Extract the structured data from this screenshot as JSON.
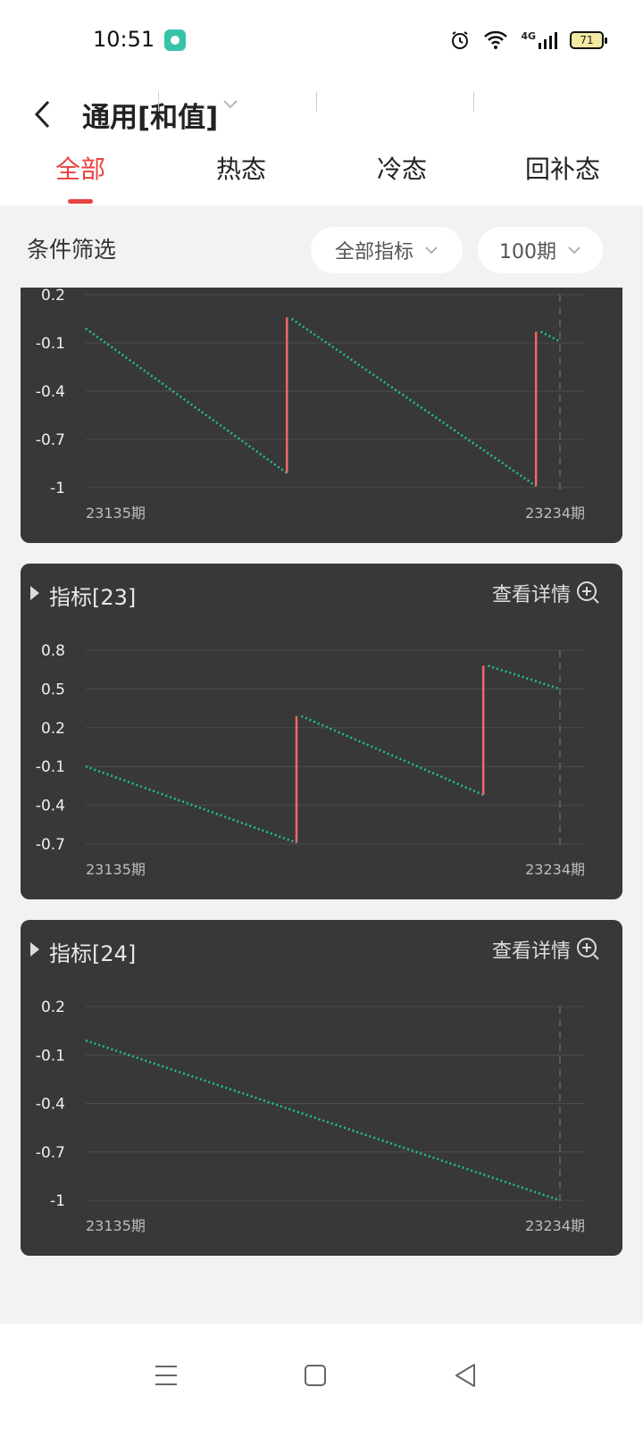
{
  "status_bar": {
    "time": "10:51",
    "network": "4G",
    "battery": "71",
    "icons": [
      "app-notification-icon",
      "alarm-icon",
      "wifi-icon",
      "signal-icon",
      "battery-icon"
    ]
  },
  "header": {
    "title": "通用[和值]",
    "tabs": [
      {
        "label": "全部",
        "active": true
      },
      {
        "label": "热态",
        "active": false
      },
      {
        "label": "冷态",
        "active": false
      },
      {
        "label": "回补态",
        "active": false
      }
    ]
  },
  "filter": {
    "label": "条件筛选",
    "indicator_select": "全部指标",
    "period_select": "100期"
  },
  "colors": {
    "accent": "#e8423f",
    "card_bg": "#383838",
    "line_green": "#1fc08a",
    "jump_red": "#ef6868"
  },
  "cards": [
    {
      "title": "",
      "detail_label": "",
      "chart_data": {
        "type": "line",
        "y_ticks": [
          "0.2",
          "-0.1",
          "-0.4",
          "-0.7",
          "-1"
        ],
        "ylim": [
          -1,
          0.2
        ],
        "x_range": [
          23135,
          23234
        ],
        "x_labels": [
          "23135期",
          "23234期"
        ],
        "segments": [
          {
            "from": [
              23135,
              -0.01
            ],
            "to": [
              23177,
              -0.91
            ]
          },
          {
            "from": [
              23178,
              0.05
            ],
            "to": [
              23229,
              -0.99
            ]
          },
          {
            "from": [
              23230,
              -0.03
            ],
            "to": [
              23234,
              -0.09
            ]
          }
        ],
        "jumps": [
          {
            "x": 23177,
            "from": -0.91,
            "to": 0.06
          },
          {
            "x": 23229,
            "from": -0.99,
            "to": -0.03
          }
        ]
      }
    },
    {
      "title": "指标[23]",
      "detail_label": "查看详情",
      "chart_data": {
        "type": "line",
        "y_ticks": [
          "0.8",
          "0.5",
          "0.2",
          "-0.1",
          "-0.4",
          "-0.7"
        ],
        "ylim": [
          -0.7,
          0.8
        ],
        "x_range": [
          23135,
          23234
        ],
        "x_labels": [
          "23135期",
          "23234期"
        ],
        "segments": [
          {
            "from": [
              23135,
              -0.1
            ],
            "to": [
              23179,
              -0.69
            ]
          },
          {
            "from": [
              23180,
              0.29
            ],
            "to": [
              23218,
              -0.32
            ]
          },
          {
            "from": [
              23219,
              0.68
            ],
            "to": [
              23234,
              0.5
            ]
          }
        ],
        "jumps": [
          {
            "x": 23179,
            "from": -0.69,
            "to": 0.29
          },
          {
            "x": 23218,
            "from": -0.32,
            "to": 0.68
          }
        ]
      }
    },
    {
      "title": "指标[24]",
      "detail_label": "查看详情",
      "chart_data": {
        "type": "line",
        "y_ticks": [
          "0.2",
          "-0.1",
          "-0.4",
          "-0.7",
          "-1"
        ],
        "ylim": [
          -1,
          0.2
        ],
        "x_range": [
          23135,
          23234
        ],
        "x_labels": [
          "23135期",
          "23234期"
        ],
        "segments": [
          {
            "from": [
              23135,
              -0.01
            ],
            "to": [
              23234,
              -1.0
            ]
          }
        ],
        "jumps": []
      }
    }
  ],
  "nav_bar": {
    "icons": [
      "menu-icon",
      "home-icon",
      "back-triangle-icon"
    ]
  }
}
